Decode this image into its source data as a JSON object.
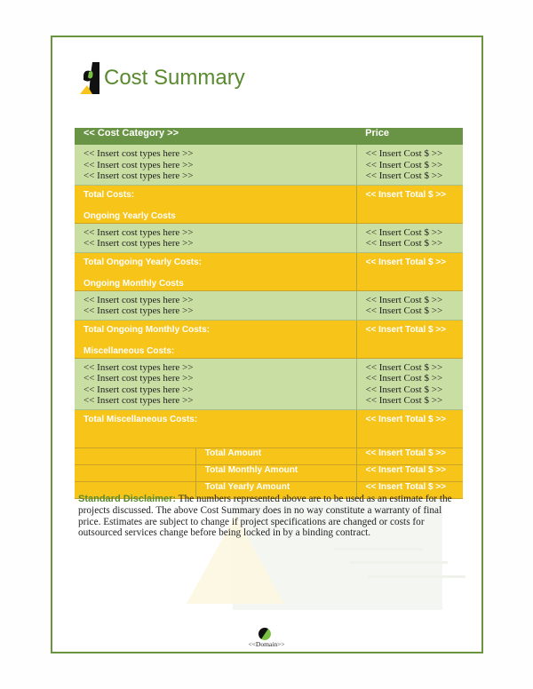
{
  "document": {
    "title": "Cost Summary",
    "colors": {
      "accent_green": "#5a8a30",
      "header_green": "#6a9445",
      "row_green": "#c9dea3",
      "row_yellow": "#f7c41a"
    }
  },
  "table": {
    "headers": {
      "category": "<< Cost Category >>",
      "price": "Price"
    },
    "sections": [
      {
        "items": [
          "<< Insert cost types here >>",
          "<< Insert cost types here >>",
          "<< Insert cost types here >>"
        ],
        "prices": [
          "<< Insert Cost $ >>",
          "<< Insert Cost $ >>",
          "<< Insert Cost $ >>"
        ],
        "total_label": "Total Costs:",
        "next_heading": "Ongoing Yearly Costs",
        "total_value": "<< Insert Total $ >>"
      },
      {
        "items": [
          "<< Insert cost types here >>",
          "<< Insert cost types here >>"
        ],
        "prices": [
          "<< Insert Cost $ >>",
          "<< Insert Cost $ >>"
        ],
        "total_label": "Total Ongoing Yearly Costs:",
        "next_heading": "Ongoing Monthly Costs",
        "total_value": "<< Insert Total $ >>"
      },
      {
        "items": [
          "<< Insert cost types here >>",
          "<< Insert cost types here >>"
        ],
        "prices": [
          "<< Insert Cost $ >>",
          "<< Insert Cost $ >>"
        ],
        "total_label": "Total Ongoing Monthly Costs:",
        "next_heading": "Miscellaneous Costs:",
        "total_value": "<< Insert Total $ >>"
      },
      {
        "items": [
          "<< Insert cost types here >>",
          "<< Insert cost types here >>",
          "<< Insert cost types here >>",
          "<< Insert cost types here >>"
        ],
        "prices": [
          "<< Insert Cost $ >>",
          "<< Insert Cost $ >>",
          "<< Insert Cost $ >>",
          "<< Insert Cost $ >>"
        ],
        "total_label": "Total Miscellaneous Costs:",
        "next_heading": "",
        "total_value": "<< Insert Total $ >>"
      }
    ],
    "summary": [
      {
        "label": "Total Amount",
        "value": "<< Insert Total $ >>"
      },
      {
        "label": "Total Monthly Amount",
        "value": "<< Insert Total $ >>"
      },
      {
        "label": "Total Yearly Amount",
        "value": "<< Insert Total $ >>"
      }
    ]
  },
  "disclaimer": {
    "lead": "Standard Disclaimer:",
    "body": " The numbers represented above are to be used as an estimate for the projects discussed. The above Cost Summary does in no way constitute a warranty of final price. Estimates are subject to change if project specifications are changed or costs for outsourced services change before being locked in by a binding contract."
  },
  "footer": {
    "domain": "<<Domain>>"
  }
}
